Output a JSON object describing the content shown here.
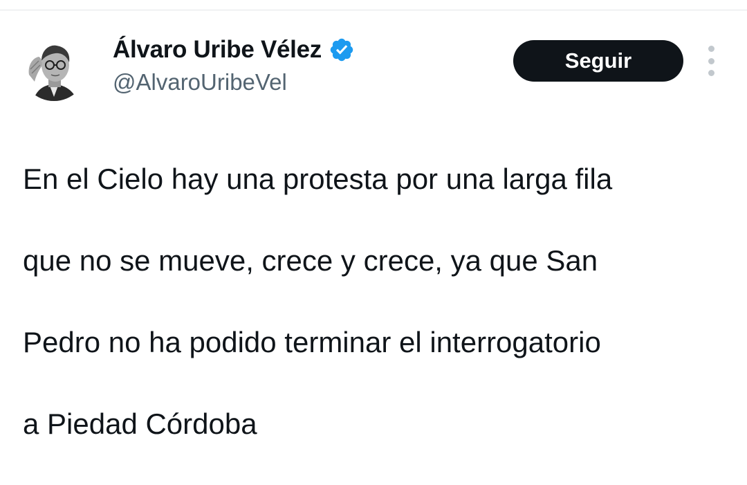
{
  "tweet": {
    "author": {
      "display_name": "Álvaro Uribe Vélez",
      "handle": "@AlvaroUribeVel",
      "avatar_icon": "avatar-photo",
      "verified_icon": "verified-badge-icon",
      "verified_color": "#1d9bf0"
    },
    "follow_button_label": "Seguir",
    "more_icon": "more-options-icon",
    "text_lines": [
      "En el Cielo hay una protesta por una larga fila",
      "que no se mueve, crece y crece, ya que San",
      "Pedro no ha podido terminar el interrogatorio",
      "a Piedad Córdoba"
    ]
  },
  "colors": {
    "text_primary": "#0f1419",
    "text_secondary": "#536471",
    "button_bg": "#0f1419",
    "button_text": "#ffffff",
    "divider": "#e3e6e8"
  }
}
